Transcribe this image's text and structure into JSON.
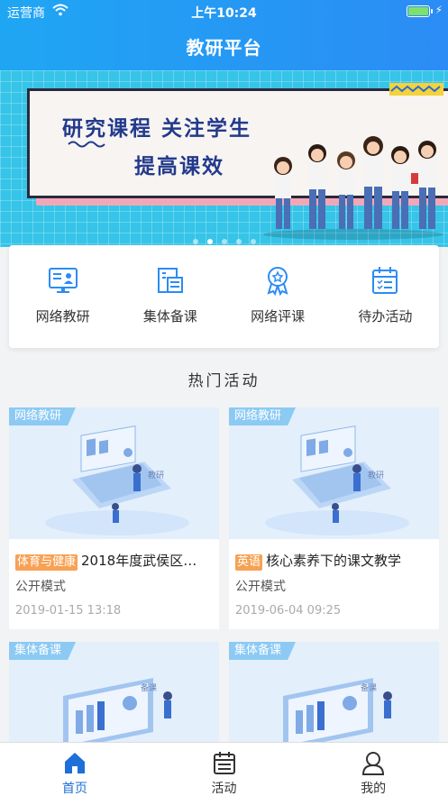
{
  "status_bar": {
    "carrier": "运营商",
    "time": "上午10:24"
  },
  "header": {
    "title": "教研平台"
  },
  "banner": {
    "line1": "研究课程  关注学生",
    "line2": "提高课效",
    "slide_count": 5,
    "active_slide": 1
  },
  "menu": [
    {
      "label": "网络教研",
      "icon": "monitor-user-icon"
    },
    {
      "label": "集体备课",
      "icon": "building-icon"
    },
    {
      "label": "网络评课",
      "icon": "medal-icon"
    },
    {
      "label": "待办活动",
      "icon": "calendar-list-icon"
    }
  ],
  "section": {
    "title": "热门活动"
  },
  "activities": [
    {
      "tag": "网络教研",
      "subject": "体育与健康",
      "title": "2018年度武侯区…",
      "mode": "公开模式",
      "date": "2019-01-15 13:18",
      "illus_caption": "教研"
    },
    {
      "tag": "网络教研",
      "subject": "英语",
      "title": "核心素养下的课文教学",
      "mode": "公开模式",
      "date": "2019-06-04 09:25",
      "illus_caption": "教研"
    },
    {
      "tag": "集体备课",
      "subject": "",
      "title": "",
      "mode": "",
      "date": "",
      "illus_caption": "备课"
    },
    {
      "tag": "集体备课",
      "subject": "",
      "title": "",
      "mode": "",
      "date": "",
      "illus_caption": "备课"
    }
  ],
  "tabbar": [
    {
      "label": "首页",
      "icon": "home-icon",
      "active": true
    },
    {
      "label": "活动",
      "icon": "calendar-icon",
      "active": false
    },
    {
      "label": "我的",
      "icon": "user-icon",
      "active": false
    }
  ],
  "colors": {
    "primary": "#2b8cf5",
    "banner": "#36c4e8",
    "subject_tag": "#f7a154",
    "active_tab": "#1e6fd8"
  }
}
